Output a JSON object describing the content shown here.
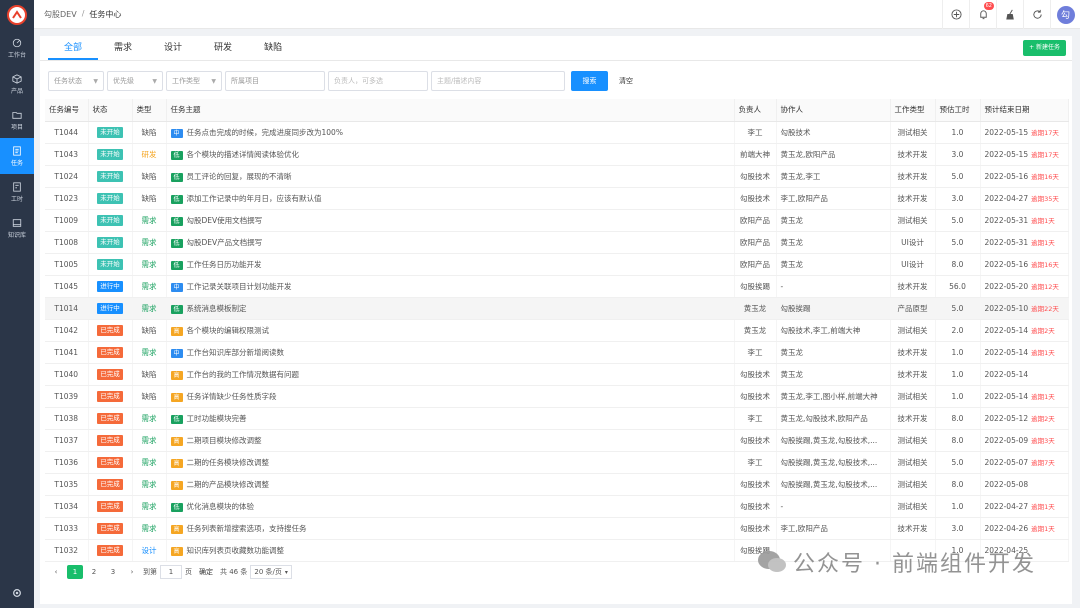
{
  "breadcrumb": [
    "勾股DEV",
    "/",
    "任务中心"
  ],
  "header": {
    "notify_count": "62",
    "avatar_text": "勾"
  },
  "sidebar": {
    "items": [
      {
        "label": "工作台",
        "icon": "dashboard-icon"
      },
      {
        "label": "产品",
        "icon": "cube-icon"
      },
      {
        "label": "项目",
        "icon": "folder-icon"
      },
      {
        "label": "任务",
        "icon": "task-icon",
        "active": true
      },
      {
        "label": "工时",
        "icon": "clock-icon"
      },
      {
        "label": "知识库",
        "icon": "book-icon"
      }
    ]
  },
  "tabs": [
    "全部",
    "需求",
    "设计",
    "研发",
    "缺陷"
  ],
  "new_task_label": "+ 新建任务",
  "filters": {
    "status": "任务状态",
    "priority": "优先级",
    "work_type": "工作类型",
    "project": "所属项目",
    "assignee_placeholder": "负责人，可多选",
    "keyword_placeholder": "主题/描述内容",
    "search_label": "搜索",
    "clear_label": "清空"
  },
  "columns": [
    "任务编号",
    "状态",
    "类型",
    "任务主题",
    "负责人",
    "协作人",
    "工作类型",
    "预估工时",
    "预计结束日期"
  ],
  "colors": {
    "not_started": "#3dc2b3",
    "in_progress": "#1890ff",
    "done": "#f56a3a",
    "pri_mid": "#2d8cf0",
    "pri_low": "#19a15f",
    "pri_high": "#f5a623"
  },
  "rows": [
    {
      "id": "T1044",
      "status": "未开始",
      "st": "not_started",
      "type": "缺陷",
      "pri": "中",
      "pc": "pri_mid",
      "subject": "任务点击完成的时候，完成进度同步改为100%",
      "owner": "李工",
      "collab": "勾股技术",
      "wtype": "测试相关",
      "hours": "1.0",
      "date": "2022-05-15",
      "over": "逾期17天"
    },
    {
      "id": "T1043",
      "status": "未开始",
      "st": "not_started",
      "type": "研发",
      "pri": "低",
      "pc": "pri_low",
      "subject": "各个模块的描述详情阅读体验优化",
      "owner": "前端大神",
      "collab": "黄玉龙,欧阳产品",
      "wtype": "技术开发",
      "hours": "3.0",
      "date": "2022-05-15",
      "over": "逾期17天"
    },
    {
      "id": "T1024",
      "status": "未开始",
      "st": "not_started",
      "type": "缺陷",
      "pri": "低",
      "pc": "pri_low",
      "subject": "员工评论的回复，展现的不清晰",
      "owner": "勾股技术",
      "collab": "黄玉龙,李工",
      "wtype": "技术开发",
      "hours": "5.0",
      "date": "2022-05-16",
      "over": "逾期16天"
    },
    {
      "id": "T1023",
      "status": "未开始",
      "st": "not_started",
      "type": "缺陷",
      "pri": "低",
      "pc": "pri_low",
      "subject": "添加工作记录中的年月日，应该有默认值",
      "owner": "勾股技术",
      "collab": "李工,欧阳产品",
      "wtype": "技术开发",
      "hours": "3.0",
      "date": "2022-04-27",
      "over": "逾期35天"
    },
    {
      "id": "T1009",
      "status": "未开始",
      "st": "not_started",
      "type": "需求",
      "pri": "低",
      "pc": "pri_low",
      "subject": "勾股DEV使用文档撰写",
      "owner": "欧阳产品",
      "collab": "黄玉龙",
      "wtype": "测试相关",
      "hours": "5.0",
      "date": "2022-05-31",
      "over": "逾期1天"
    },
    {
      "id": "T1008",
      "status": "未开始",
      "st": "not_started",
      "type": "需求",
      "pri": "低",
      "pc": "pri_low",
      "subject": "勾股DEV产品文档撰写",
      "owner": "欧阳产品",
      "collab": "黄玉龙",
      "wtype": "UI设计",
      "hours": "5.0",
      "date": "2022-05-31",
      "over": "逾期1天"
    },
    {
      "id": "T1005",
      "status": "未开始",
      "st": "not_started",
      "type": "需求",
      "pri": "低",
      "pc": "pri_low",
      "subject": "工作任务日历功能开发",
      "owner": "欧阳产品",
      "collab": "黄玉龙",
      "wtype": "UI设计",
      "hours": "8.0",
      "date": "2022-05-16",
      "over": "逾期16天"
    },
    {
      "id": "T1045",
      "status": "进行中",
      "st": "in_progress",
      "type": "需求",
      "pri": "中",
      "pc": "pri_mid",
      "subject": "工作记录关联项目计划功能开发",
      "owner": "勾股挨踢",
      "collab": "-",
      "wtype": "技术开发",
      "hours": "56.0",
      "date": "2022-05-20",
      "over": "逾期12天"
    },
    {
      "id": "T1014",
      "status": "进行中",
      "st": "in_progress",
      "type": "需求",
      "pri": "低",
      "pc": "pri_low",
      "subject": "系统消息模板制定",
      "owner": "黄玉龙",
      "collab": "勾股挨踢",
      "wtype": "产品原型",
      "hours": "5.0",
      "date": "2022-05-10",
      "over": "逾期22天",
      "hl": true
    },
    {
      "id": "T1042",
      "status": "已完成",
      "st": "done",
      "type": "缺陷",
      "pri": "高",
      "pc": "pri_high",
      "subject": "各个模块的编辑权限测试",
      "owner": "黄玉龙",
      "collab": "勾股技术,李工,前端大神",
      "wtype": "测试相关",
      "hours": "2.0",
      "date": "2022-05-14",
      "over": "逾期2天"
    },
    {
      "id": "T1041",
      "status": "已完成",
      "st": "done",
      "type": "需求",
      "pri": "中",
      "pc": "pri_mid",
      "subject": "工作台知识库部分新增阅读数",
      "owner": "李工",
      "collab": "黄玉龙",
      "wtype": "技术开发",
      "hours": "1.0",
      "date": "2022-05-14",
      "over": "逾期1天"
    },
    {
      "id": "T1040",
      "status": "已完成",
      "st": "done",
      "type": "缺陷",
      "pri": "高",
      "pc": "pri_high",
      "subject": "工作台的我的工作情况数据有问题",
      "owner": "勾股技术",
      "collab": "黄玉龙",
      "wtype": "技术开发",
      "hours": "1.0",
      "date": "2022-05-14",
      "over": ""
    },
    {
      "id": "T1039",
      "status": "已完成",
      "st": "done",
      "type": "缺陷",
      "pri": "高",
      "pc": "pri_high",
      "subject": "任务详情缺少任务性质字段",
      "owner": "勾股技术",
      "collab": "黄玉龙,李工,图小样,前端大神",
      "wtype": "测试相关",
      "hours": "1.0",
      "date": "2022-05-14",
      "over": "逾期1天"
    },
    {
      "id": "T1038",
      "status": "已完成",
      "st": "done",
      "type": "需求",
      "pri": "低",
      "pc": "pri_low",
      "subject": "工时功能模块完善",
      "owner": "李工",
      "collab": "黄玉龙,勾股技术,欧阳产品",
      "wtype": "技术开发",
      "hours": "8.0",
      "date": "2022-05-12",
      "over": "逾期2天"
    },
    {
      "id": "T1037",
      "status": "已完成",
      "st": "done",
      "type": "需求",
      "pri": "高",
      "pc": "pri_high",
      "subject": "二期项目模块修改调整",
      "owner": "勾股技术",
      "collab": "勾股挨踢,黄玉龙,勾股技术,...",
      "wtype": "测试相关",
      "hours": "8.0",
      "date": "2022-05-09",
      "over": "逾期3天"
    },
    {
      "id": "T1036",
      "status": "已完成",
      "st": "done",
      "type": "需求",
      "pri": "高",
      "pc": "pri_high",
      "subject": "二期的任务模块修改调整",
      "owner": "李工",
      "collab": "勾股挨踢,黄玉龙,勾股技术,...",
      "wtype": "测试相关",
      "hours": "5.0",
      "date": "2022-05-07",
      "over": "逾期7天"
    },
    {
      "id": "T1035",
      "status": "已完成",
      "st": "done",
      "type": "需求",
      "pri": "高",
      "pc": "pri_high",
      "subject": "二期的产品模块修改调整",
      "owner": "勾股技术",
      "collab": "勾股挨踢,黄玉龙,勾股技术,...",
      "wtype": "测试相关",
      "hours": "8.0",
      "date": "2022-05-08",
      "over": ""
    },
    {
      "id": "T1034",
      "status": "已完成",
      "st": "done",
      "type": "需求",
      "pri": "低",
      "pc": "pri_low",
      "subject": "优化消息模块的体验",
      "owner": "勾股技术",
      "collab": "-",
      "wtype": "测试相关",
      "hours": "1.0",
      "date": "2022-04-27",
      "over": "逾期1天"
    },
    {
      "id": "T1033",
      "status": "已完成",
      "st": "done",
      "type": "需求",
      "pri": "高",
      "pc": "pri_high",
      "subject": "任务列表新增搜索选项，支持搜任务",
      "owner": "勾股技术",
      "collab": "李工,欧阳产品",
      "wtype": "技术开发",
      "hours": "3.0",
      "date": "2022-04-26",
      "over": "逾期1天"
    },
    {
      "id": "T1032",
      "status": "已完成",
      "st": "done",
      "type": "设计",
      "pri": "高",
      "pc": "pri_high",
      "subject": "知识库列表页收藏数功能调整",
      "owner": "勾股挨踢",
      "collab": "",
      "wtype": "",
      "hours": "1.0",
      "date": "2022-04-25",
      "over": ""
    }
  ],
  "pagination": {
    "pages": [
      "1",
      "2",
      "3"
    ],
    "goto_label": "到第",
    "goto_value": "1",
    "page_unit": "页",
    "confirm": "确定",
    "total": "共 46 条",
    "size": "20 条/页"
  },
  "watermark": "公众号 · 前端组件开发"
}
